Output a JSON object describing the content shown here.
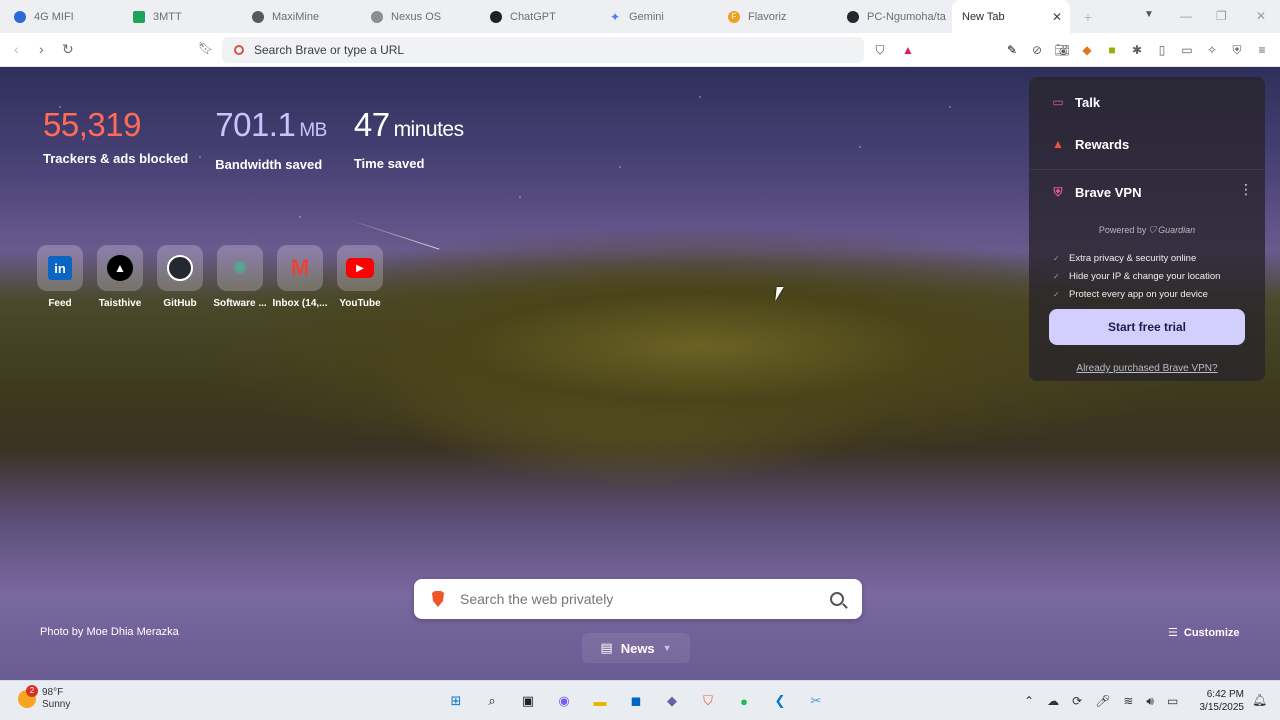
{
  "browser": {
    "tabs": [
      {
        "label": "4G MIFI",
        "favicon_color": "#2a6bd8",
        "active": false
      },
      {
        "label": "3MTT",
        "favicon_color": "#1ea45a",
        "active": false
      },
      {
        "label": "MaxiMine",
        "favicon_color": "#555a60",
        "active": false
      },
      {
        "label": "Nexus OS",
        "favicon_color": "#8a8d92",
        "active": false
      },
      {
        "label": "ChatGPT",
        "favicon_color": "#202123",
        "active": false
      },
      {
        "label": "Gemini",
        "favicon_color": "#4a7ef6",
        "active": false
      },
      {
        "label": "Flavoriz",
        "favicon_color": "#f0a020",
        "active": false
      },
      {
        "label": "PC-Ngumoha/ta",
        "favicon_color": "#24292f",
        "active": false
      },
      {
        "label": "New Tab",
        "favicon_color": "",
        "active": true
      }
    ],
    "new_tab_symbol": "+",
    "url_placeholder": "Search Brave or type a URL"
  },
  "stats": {
    "trackers": {
      "value": "55,319",
      "label": "Trackers & ads blocked"
    },
    "bandwidth": {
      "value": "701.1",
      "unit": "MB",
      "label": "Bandwidth saved"
    },
    "time": {
      "value": "47",
      "unit": "minutes",
      "label": "Time saved"
    }
  },
  "top_sites": [
    {
      "label": "Feed",
      "icon": "linkedin-icon"
    },
    {
      "label": "Taisthive",
      "icon": "triangle-logo-icon"
    },
    {
      "label": "GitHub",
      "icon": "github-icon"
    },
    {
      "label": "Software ...",
      "icon": "gear-globe-icon"
    },
    {
      "label": "Inbox (14,...",
      "icon": "gmail-icon"
    },
    {
      "label": "YouTube",
      "icon": "youtube-icon"
    }
  ],
  "widgets": {
    "talk": "Talk",
    "rewards": "Rewards",
    "vpn": {
      "title": "Brave VPN",
      "powered_by": "Powered by",
      "powered_brand": "Guardian",
      "features": [
        "Extra privacy & security online",
        "Hide your IP & change your location",
        "Protect every app on your device"
      ],
      "cta": "Start free trial",
      "purchased_link": "Already purchased Brave VPN?"
    }
  },
  "search": {
    "placeholder": "Search the web privately"
  },
  "photo_credit": "Photo by Moe Dhia Merazka",
  "news_label": "News",
  "customize_label": "Customize",
  "taskbar": {
    "weather": {
      "temp": "98°F",
      "condition": "Sunny",
      "badge": "2"
    },
    "time": "6:42 PM",
    "date": "3/15/2025"
  },
  "colors": {
    "trackers_accent": "#ff6b57",
    "bandwidth_accent": "#c9c4ff",
    "vpn_button": "#d2cefe"
  }
}
